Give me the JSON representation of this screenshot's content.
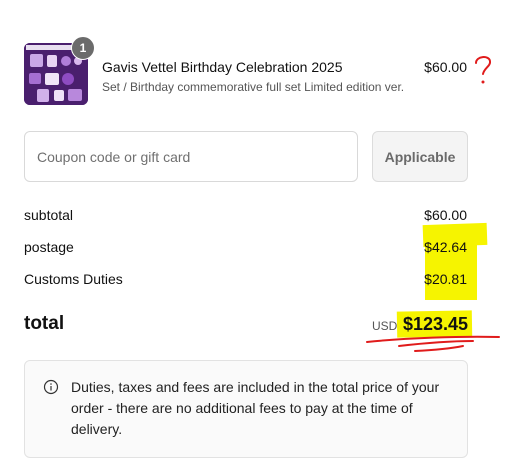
{
  "product": {
    "quantity": "1",
    "name": "Gavis Vettel Birthday Celebration 2025",
    "variant": "Set / Birthday commemorative full set Limited edition ver.",
    "price": "$60.00",
    "thumbnail_icon": "merch-set-image"
  },
  "coupon": {
    "placeholder": "Coupon code or gift card",
    "value": "",
    "apply_label": "Applicable"
  },
  "summary": {
    "subtotal_label": "subtotal",
    "subtotal_value": "$60.00",
    "postage_label": "postage",
    "postage_value": "$42.64",
    "customs_label": "Customs Duties",
    "customs_value": "$20.81"
  },
  "total": {
    "label": "total",
    "currency": "USD",
    "amount": "$123.45"
  },
  "notice": {
    "icon": "info-icon",
    "text": "Duties, taxes and fees are included in the total price of your order - there are no additional fees to pay at the time of delivery."
  },
  "colors": {
    "highlight": "#f6f400",
    "annotation": "#e01b1b",
    "thumbnail_bg": "#4a1f6e"
  }
}
